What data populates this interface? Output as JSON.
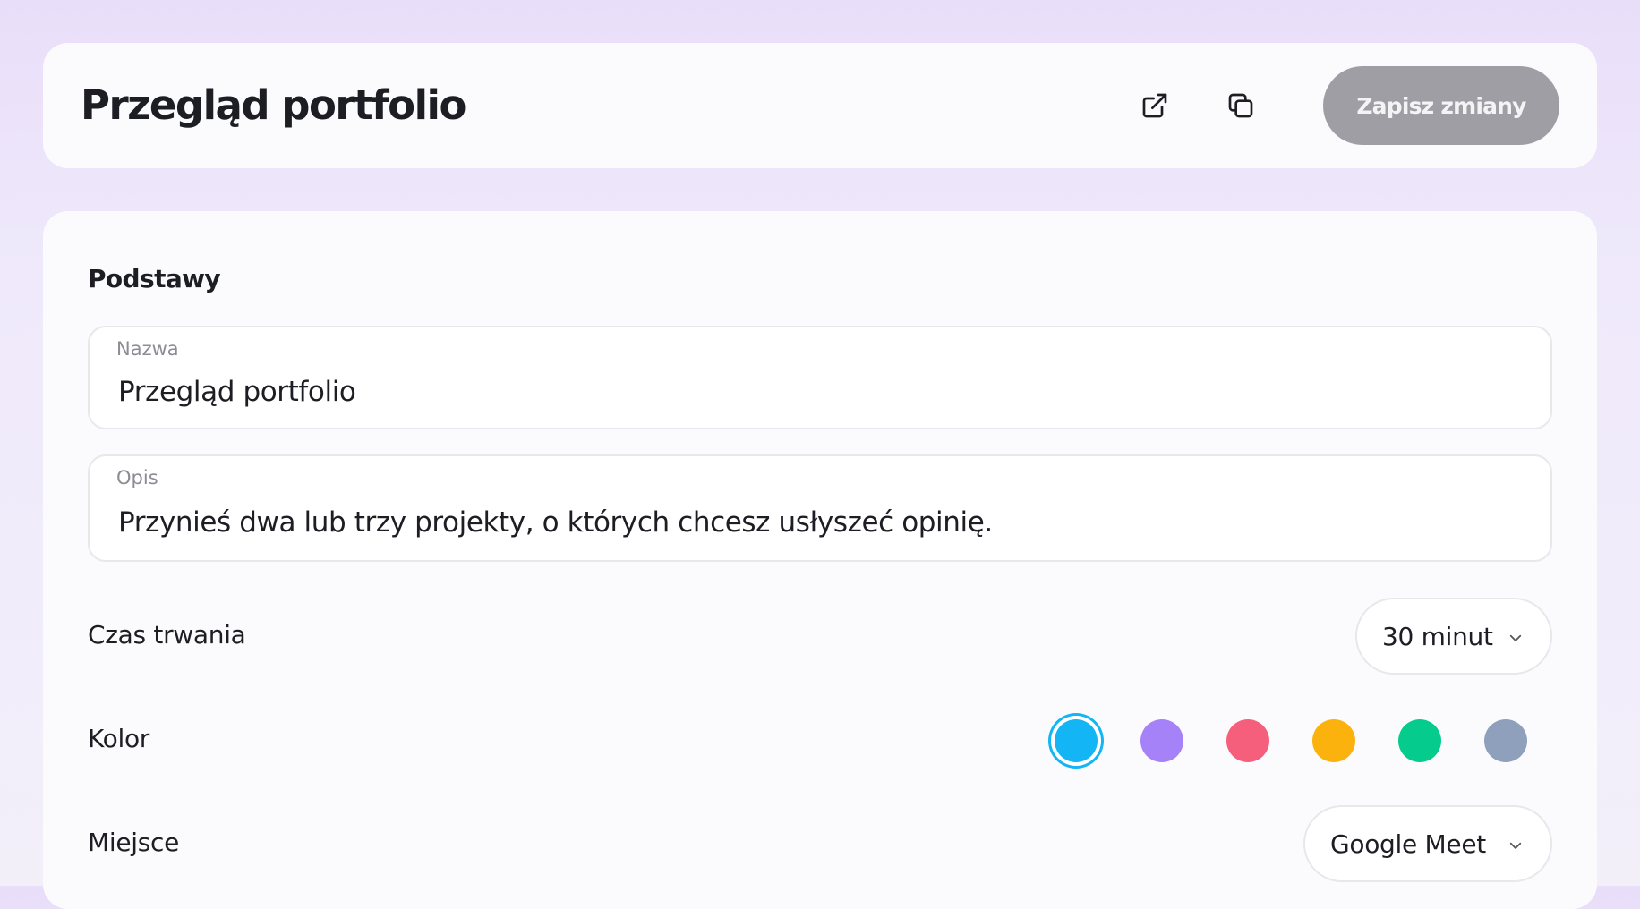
{
  "header": {
    "title": "Przegląd portfolio",
    "save_label": "Zapisz zmiany",
    "icons": [
      "external-link-icon",
      "copy-icon"
    ]
  },
  "basics": {
    "section_title": "Podstawy",
    "name": {
      "label": "Nazwa",
      "value": "Przegląd portfolio"
    },
    "description": {
      "label": "Opis",
      "value": "Przynieś dwa lub trzy projekty, o których chcesz usłyszeć opinię."
    },
    "duration": {
      "label": "Czas trwania",
      "value": "30 minut"
    },
    "color": {
      "label": "Kolor",
      "options": [
        "#14b5f5",
        "#a582f7",
        "#f65f7c",
        "#fcb20d",
        "#05cc8c",
        "#8ea0bb"
      ],
      "selected": "#14b5f5"
    },
    "location": {
      "label": "Miejsce",
      "value": "Google Meet"
    }
  },
  "colors": {
    "accent": "#14b5f5",
    "save_button_bg": "#9e9ea4"
  }
}
